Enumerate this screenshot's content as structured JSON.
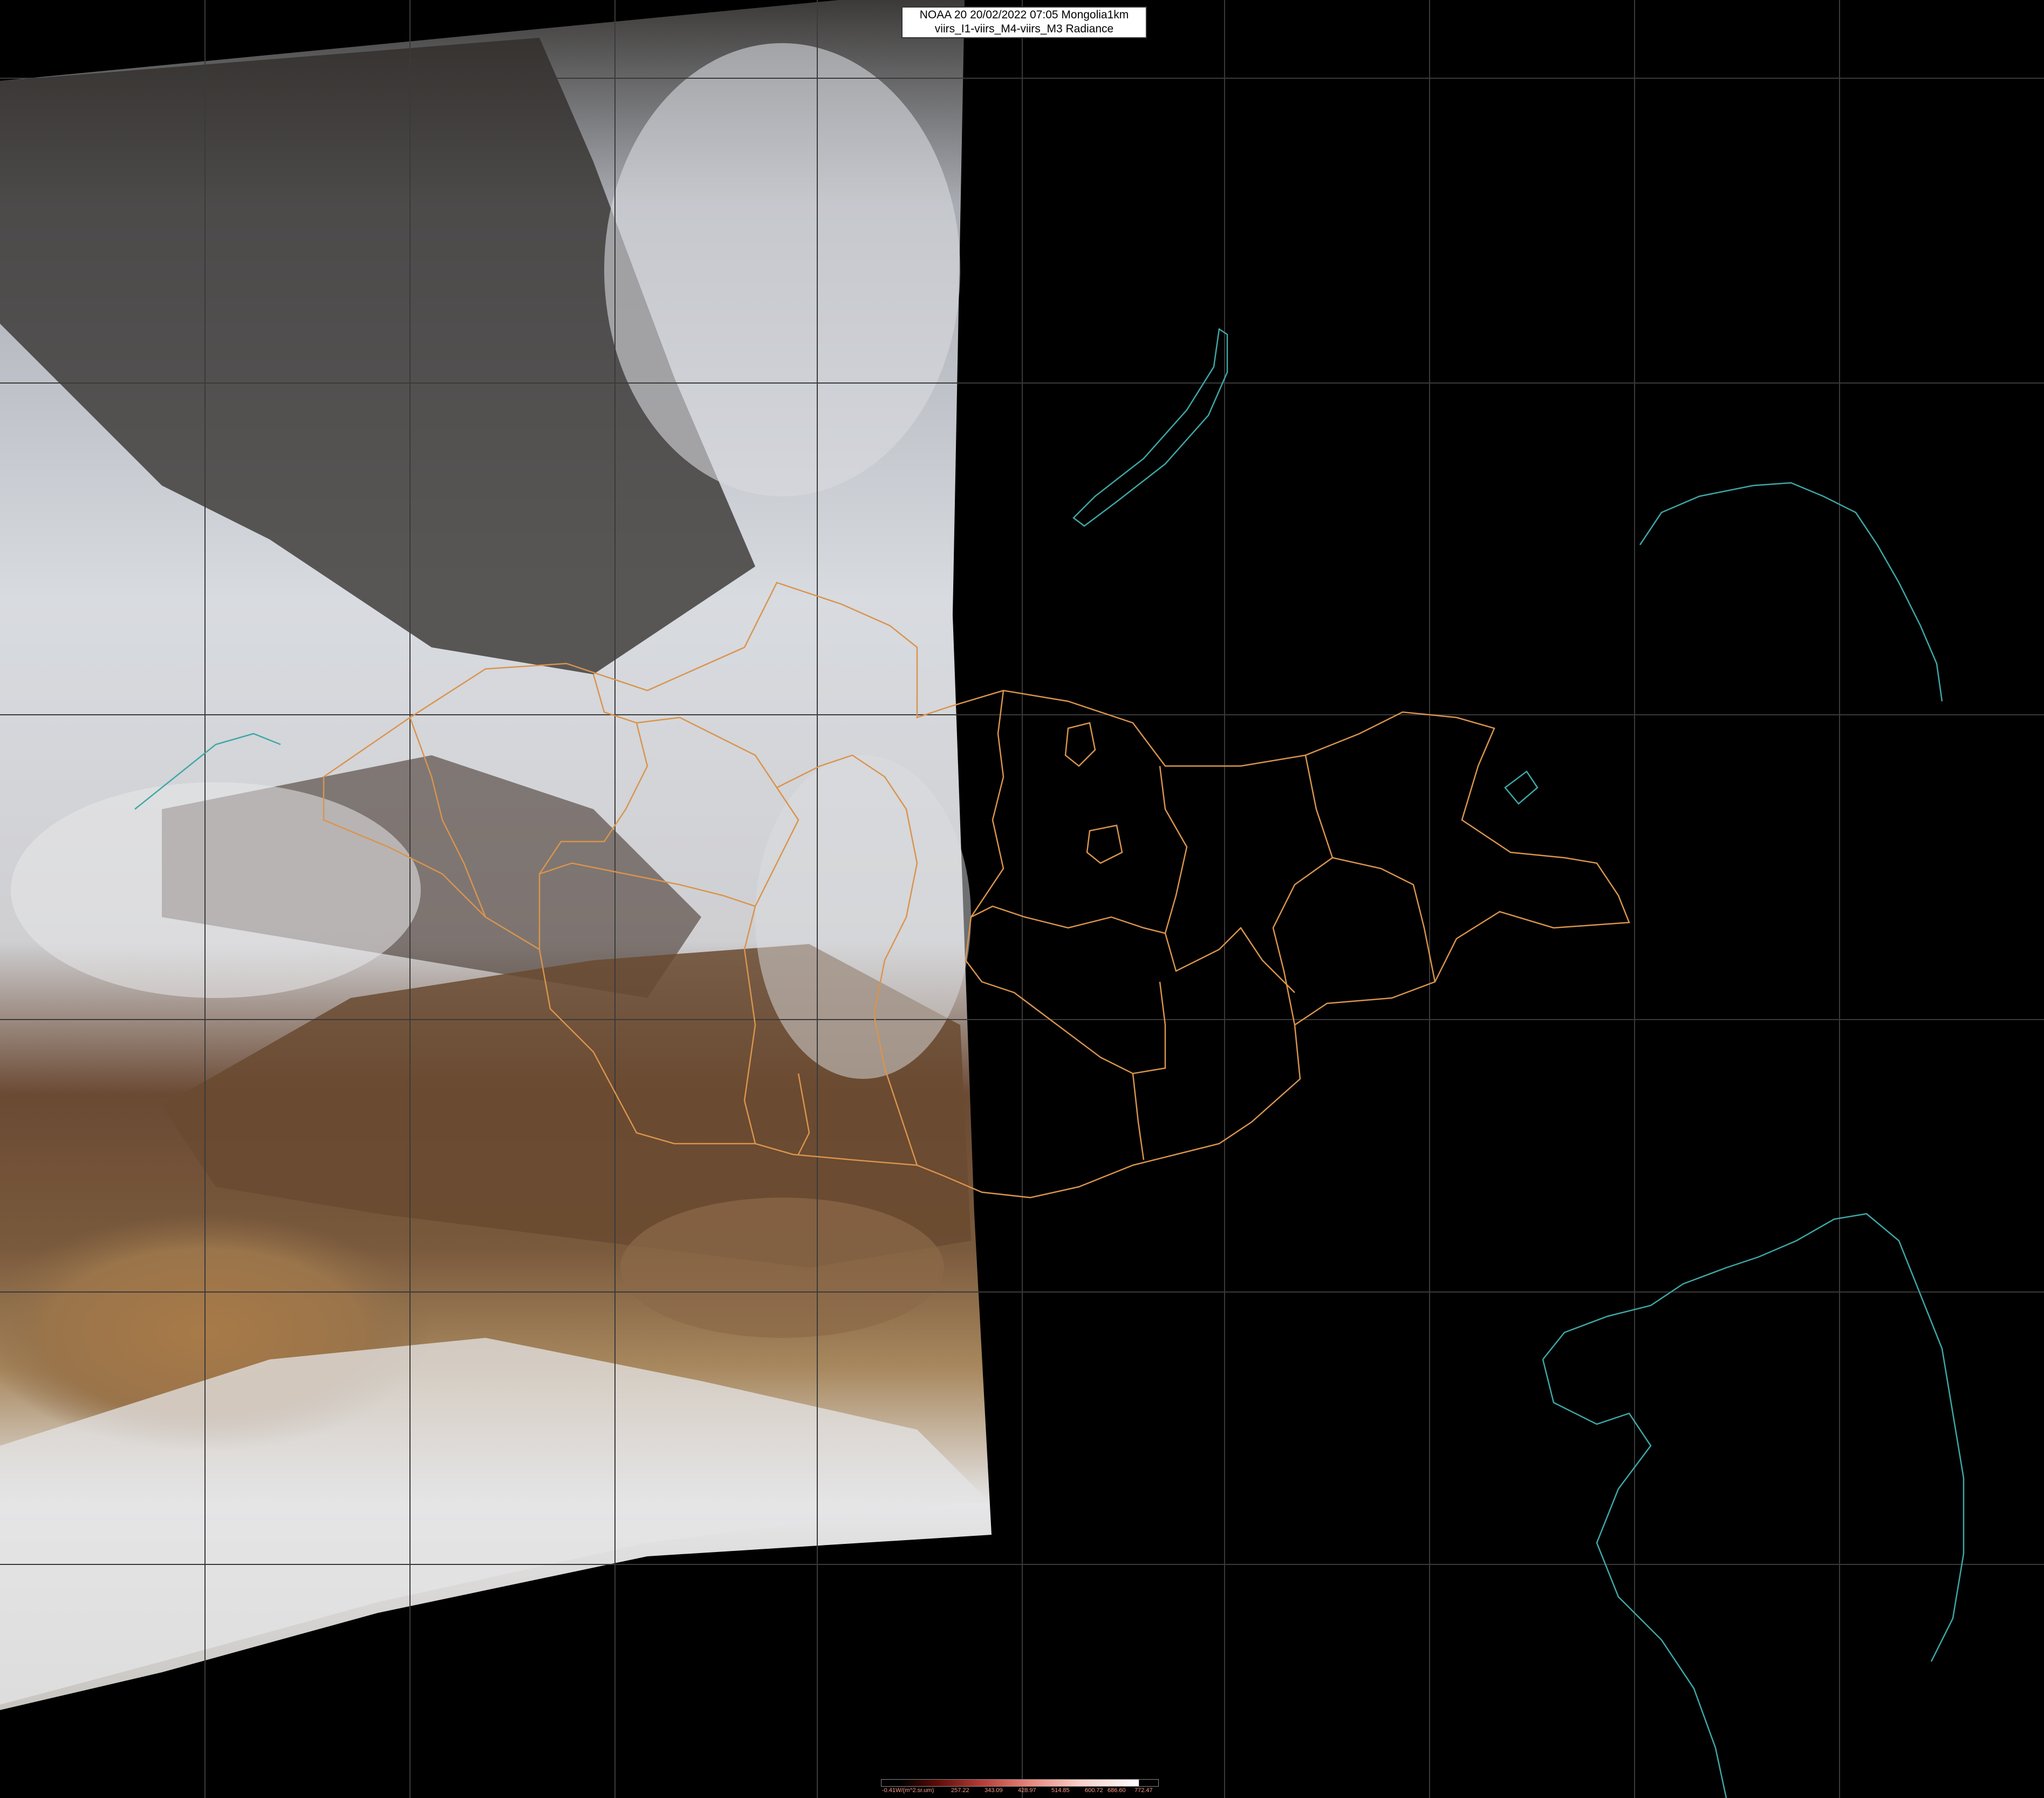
{
  "title": {
    "line1": "NOAA 20 20/02/2022 07:05 Mongolia1km",
    "line2": "viirs_I1-viirs_M4-viirs_M3 Radiance"
  },
  "legend": {
    "unit_label": "-0.41W/(m^2.sr.um)",
    "ticks": [
      "257.22",
      "343.09",
      "428.97",
      "514.85",
      "600.72",
      "686.60",
      "772.47"
    ]
  },
  "colors": {
    "background": "#000000",
    "border_orange": "#d9944d",
    "coast_cyan": "#3fa7a7",
    "graticule": "#3a3a3a"
  },
  "icons": []
}
